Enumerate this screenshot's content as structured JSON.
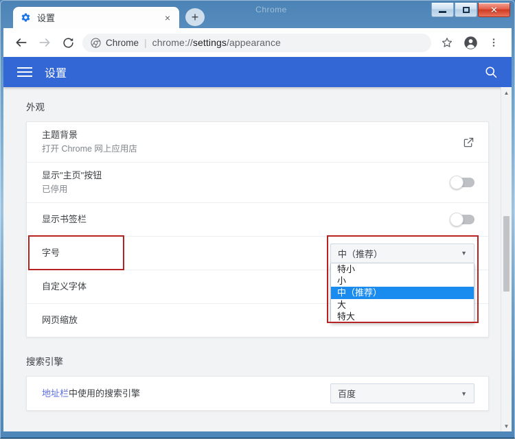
{
  "window": {
    "ghost_title": "Chrome",
    "buttons": {
      "minimize": "minimize",
      "maximize": "maximize",
      "close": "close"
    }
  },
  "tab": {
    "title": "设置",
    "favicon": "gear-icon",
    "close_label": "×",
    "new_tab_label": "+"
  },
  "toolbar": {
    "back": "←",
    "forward": "→",
    "reload": "⟳",
    "omnibox": {
      "security_chip": "Chrome",
      "divider": "|",
      "url_prefix": "chrome://",
      "url_strong": "settings",
      "url_suffix": "/appearance",
      "full_url": "chrome://settings/appearance"
    },
    "bookmark_icon": "star-icon",
    "profile_icon": "account-avatar-icon",
    "menu_icon": "three-dot-menu-icon"
  },
  "settings_header": {
    "menu_icon": "hamburger-menu-icon",
    "title": "设置",
    "search_icon": "search-icon"
  },
  "appearance": {
    "section_title": "外观",
    "rows": [
      {
        "label": "主题背景",
        "sub": "打开 Chrome 网上应用店",
        "control": "external-link"
      },
      {
        "label": "显示\"主页\"按钮",
        "sub": "已停用",
        "control": "toggle",
        "toggle_on": false
      },
      {
        "label": "显示书签栏",
        "sub": "",
        "control": "toggle",
        "toggle_on": false
      },
      {
        "label": "字号",
        "sub": "",
        "control": "select",
        "value": "中（推荐）"
      },
      {
        "label": "自定义字体",
        "sub": "",
        "control": "none"
      },
      {
        "label": "网页缩放",
        "sub": "",
        "control": "none"
      }
    ],
    "font_size_options": [
      "特小",
      "小",
      "中（推荐）",
      "大",
      "特大"
    ],
    "font_size_selected": "中（推荐）"
  },
  "search_engine": {
    "section_title": "搜索引擎",
    "row_label_highlight": "地址栏",
    "row_label_rest": "中使用的搜索引擎",
    "value": "百度"
  },
  "colors": {
    "accent_blue": "#3367d6",
    "highlight_blue": "#1a8bef",
    "annotation_red": "#b42222",
    "close_button_red": "#cf3b24"
  },
  "annotations": [
    {
      "name": "font-size-label-highlight",
      "target": "字号"
    },
    {
      "name": "font-size-dropdown-highlight",
      "target": "中（推荐）"
    }
  ],
  "scrollbar": {
    "up_arrow": "▲",
    "down_arrow": "▼"
  }
}
